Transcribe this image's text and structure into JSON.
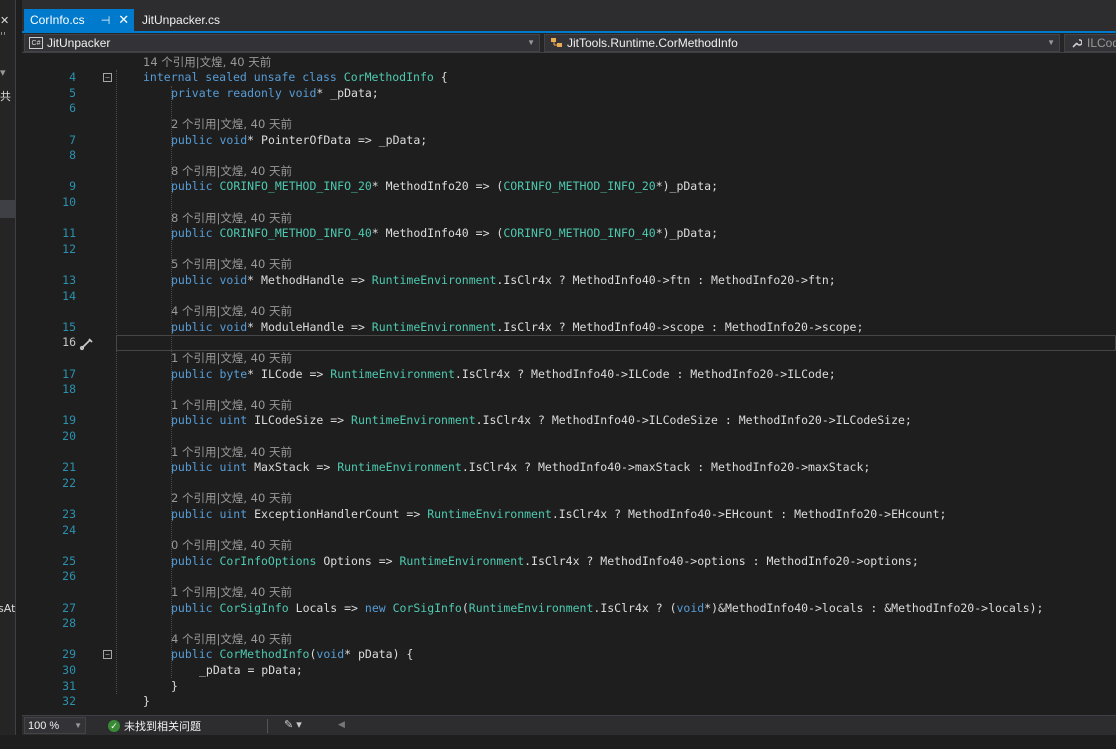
{
  "left_panel": {
    "close_glyph": "✕",
    "quote_glyph": "''",
    "dropdown_glyph": "▾",
    "share_char": "共",
    "partial_text": "sAt"
  },
  "tabs": [
    {
      "label": "CorInfo.cs",
      "pin": "⊣",
      "close": "✕",
      "active": true
    },
    {
      "label": "JitUnpacker.cs",
      "active": false
    }
  ],
  "navbar": {
    "project": {
      "icon": "csharp-project-icon",
      "icon_text": "C#",
      "label": "JitUnpacker"
    },
    "type": {
      "icon": "class-icon",
      "label": "JitTools.Runtime.CorMethodInfo"
    },
    "member": {
      "icon": "wrench-icon",
      "label": "ILCod"
    }
  },
  "colors": {
    "keyword": "#569cd6",
    "type": "#4ec9b0",
    "line_number": "#2b91af",
    "lens": "#999999",
    "accent": "#007acc",
    "status_ok": "#388a34"
  },
  "code_lines": [
    {
      "lens": "14 个引用|文煌, 40 天前"
    },
    {
      "num": "4",
      "fold": "−",
      "indent": 0,
      "tokens": [
        [
          "kw",
          "internal sealed unsafe class "
        ],
        [
          "ty",
          "CorMethodInfo"
        ],
        [
          "p",
          " {"
        ]
      ]
    },
    {
      "num": "5",
      "indent": 1,
      "tokens": [
        [
          "kw",
          "private readonly void"
        ],
        [
          "p",
          "* _pData;"
        ]
      ]
    },
    {
      "num": "6",
      "indent": 1,
      "tokens": []
    },
    {
      "lens": "2 个引用|文煌, 40 天前",
      "indent": 1
    },
    {
      "num": "7",
      "indent": 1,
      "tokens": [
        [
          "kw",
          "public void"
        ],
        [
          "p",
          "* PointerOfData => _pData;"
        ]
      ]
    },
    {
      "num": "8",
      "indent": 1,
      "tokens": []
    },
    {
      "lens": "8 个引用|文煌, 40 天前",
      "indent": 1
    },
    {
      "num": "9",
      "indent": 1,
      "tokens": [
        [
          "kw",
          "public "
        ],
        [
          "ty",
          "CORINFO_METHOD_INFO_20"
        ],
        [
          "p",
          "* MethodInfo20 => ("
        ],
        [
          "ty",
          "CORINFO_METHOD_INFO_20"
        ],
        [
          "p",
          "*)_pData;"
        ]
      ]
    },
    {
      "num": "10",
      "indent": 1,
      "tokens": []
    },
    {
      "lens": "8 个引用|文煌, 40 天前",
      "indent": 1
    },
    {
      "num": "11",
      "indent": 1,
      "tokens": [
        [
          "kw",
          "public "
        ],
        [
          "ty",
          "CORINFO_METHOD_INFO_40"
        ],
        [
          "p",
          "* MethodInfo40 => ("
        ],
        [
          "ty",
          "CORINFO_METHOD_INFO_40"
        ],
        [
          "p",
          "*)_pData;"
        ]
      ]
    },
    {
      "num": "12",
      "indent": 1,
      "tokens": []
    },
    {
      "lens": "5 个引用|文煌, 40 天前",
      "indent": 1
    },
    {
      "num": "13",
      "indent": 1,
      "tokens": [
        [
          "kw",
          "public void"
        ],
        [
          "p",
          "* MethodHandle => "
        ],
        [
          "ty",
          "RuntimeEnvironment"
        ],
        [
          "p",
          ".IsClr4x ? MethodInfo40->ftn : MethodInfo20->ftn;"
        ]
      ]
    },
    {
      "num": "14",
      "indent": 1,
      "tokens": []
    },
    {
      "lens": "4 个引用|文煌, 40 天前",
      "indent": 1
    },
    {
      "num": "15",
      "indent": 1,
      "tokens": [
        [
          "kw",
          "public void"
        ],
        [
          "p",
          "* ModuleHandle => "
        ],
        [
          "ty",
          "RuntimeEnvironment"
        ],
        [
          "p",
          ".IsClr4x ? MethodInfo40->scope : MethodInfo20->scope;"
        ]
      ]
    },
    {
      "num": "16",
      "indent": 1,
      "tokens": [],
      "current": true
    },
    {
      "lens": "1 个引用|文煌, 40 天前",
      "indent": 1
    },
    {
      "num": "17",
      "indent": 1,
      "tokens": [
        [
          "kw",
          "public byte"
        ],
        [
          "p",
          "* ILCode => "
        ],
        [
          "ty",
          "RuntimeEnvironment"
        ],
        [
          "p",
          ".IsClr4x ? MethodInfo40->ILCode : MethodInfo20->ILCode;"
        ]
      ]
    },
    {
      "num": "18",
      "indent": 1,
      "tokens": []
    },
    {
      "lens": "1 个引用|文煌, 40 天前",
      "indent": 1
    },
    {
      "num": "19",
      "indent": 1,
      "tokens": [
        [
          "kw",
          "public uint"
        ],
        [
          "p",
          " ILCodeSize => "
        ],
        [
          "ty",
          "RuntimeEnvironment"
        ],
        [
          "p",
          ".IsClr4x ? MethodInfo40->ILCodeSize : MethodInfo20->ILCodeSize;"
        ]
      ]
    },
    {
      "num": "20",
      "indent": 1,
      "tokens": []
    },
    {
      "lens": "1 个引用|文煌, 40 天前",
      "indent": 1
    },
    {
      "num": "21",
      "indent": 1,
      "tokens": [
        [
          "kw",
          "public uint"
        ],
        [
          "p",
          " MaxStack => "
        ],
        [
          "ty",
          "RuntimeEnvironment"
        ],
        [
          "p",
          ".IsClr4x ? MethodInfo40->maxStack : MethodInfo20->maxStack;"
        ]
      ]
    },
    {
      "num": "22",
      "indent": 1,
      "tokens": []
    },
    {
      "lens": "2 个引用|文煌, 40 天前",
      "indent": 1
    },
    {
      "num": "23",
      "indent": 1,
      "tokens": [
        [
          "kw",
          "public uint"
        ],
        [
          "p",
          " ExceptionHandlerCount => "
        ],
        [
          "ty",
          "RuntimeEnvironment"
        ],
        [
          "p",
          ".IsClr4x ? MethodInfo40->EHcount : MethodInfo20->EHcount;"
        ]
      ]
    },
    {
      "num": "24",
      "indent": 1,
      "tokens": []
    },
    {
      "lens": "0 个引用|文煌, 40 天前",
      "indent": 1
    },
    {
      "num": "25",
      "indent": 1,
      "tokens": [
        [
          "kw",
          "public "
        ],
        [
          "ty",
          "CorInfoOptions"
        ],
        [
          "p",
          " Options => "
        ],
        [
          "ty",
          "RuntimeEnvironment"
        ],
        [
          "p",
          ".IsClr4x ? MethodInfo40->options : MethodInfo20->options;"
        ]
      ]
    },
    {
      "num": "26",
      "indent": 1,
      "tokens": []
    },
    {
      "lens": "1 个引用|文煌, 40 天前",
      "indent": 1
    },
    {
      "num": "27",
      "indent": 1,
      "tokens": [
        [
          "kw",
          "public "
        ],
        [
          "ty",
          "CorSigInfo"
        ],
        [
          "p",
          " Locals => "
        ],
        [
          "kw",
          "new "
        ],
        [
          "ty",
          "CorSigInfo"
        ],
        [
          "p",
          "("
        ],
        [
          "ty",
          "RuntimeEnvironment"
        ],
        [
          "p",
          ".IsClr4x ? ("
        ],
        [
          "kw",
          "void"
        ],
        [
          "p",
          "*)&MethodInfo40->locals : &MethodInfo20->locals);"
        ]
      ]
    },
    {
      "num": "28",
      "indent": 1,
      "tokens": []
    },
    {
      "lens": "4 个引用|文煌, 40 天前",
      "indent": 1
    },
    {
      "num": "29",
      "fold": "−",
      "indent": 1,
      "tokens": [
        [
          "kw",
          "public "
        ],
        [
          "ty",
          "CorMethodInfo"
        ],
        [
          "p",
          "("
        ],
        [
          "kw",
          "void"
        ],
        [
          "p",
          "* pData) {"
        ]
      ]
    },
    {
      "num": "30",
      "indent": 2,
      "tokens": [
        [
          "p",
          "_pData = pData;"
        ]
      ]
    },
    {
      "num": "31",
      "indent": 1,
      "tokens": [
        [
          "p",
          "}"
        ]
      ]
    },
    {
      "num": "32",
      "indent": 0,
      "tokens": [
        [
          "p",
          "}"
        ]
      ]
    }
  ],
  "statusbar": {
    "zoom": "100 %",
    "issues_text": "未找到相关问题",
    "issues_icon": "check-circle-icon"
  }
}
